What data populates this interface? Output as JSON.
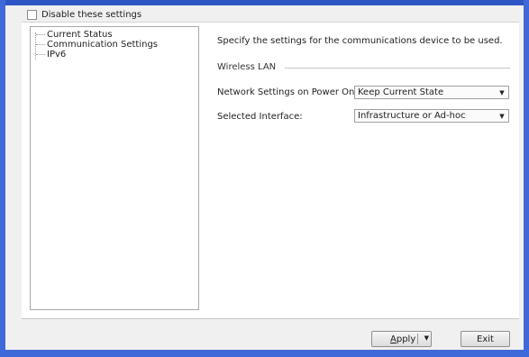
{
  "disable_settings": {
    "label": "Disable these settings",
    "checked": false
  },
  "tree": {
    "items": [
      {
        "label": "Current Status"
      },
      {
        "label": "Communication Settings"
      },
      {
        "label": "IPv6"
      }
    ]
  },
  "main": {
    "description": "Specify the settings for the communications device to be used.",
    "group_label": "Wireless LAN",
    "fields": [
      {
        "label": "Network Settings on Power On:",
        "value": "Keep Current State"
      },
      {
        "label": "Selected Interface:",
        "value": "Infrastructure or Ad-hoc"
      }
    ]
  },
  "footer": {
    "apply_first_letter": "A",
    "apply_rest": "pply",
    "exit_label": "Exit"
  },
  "icons": {
    "dropdown": "chevron-down-icon"
  }
}
